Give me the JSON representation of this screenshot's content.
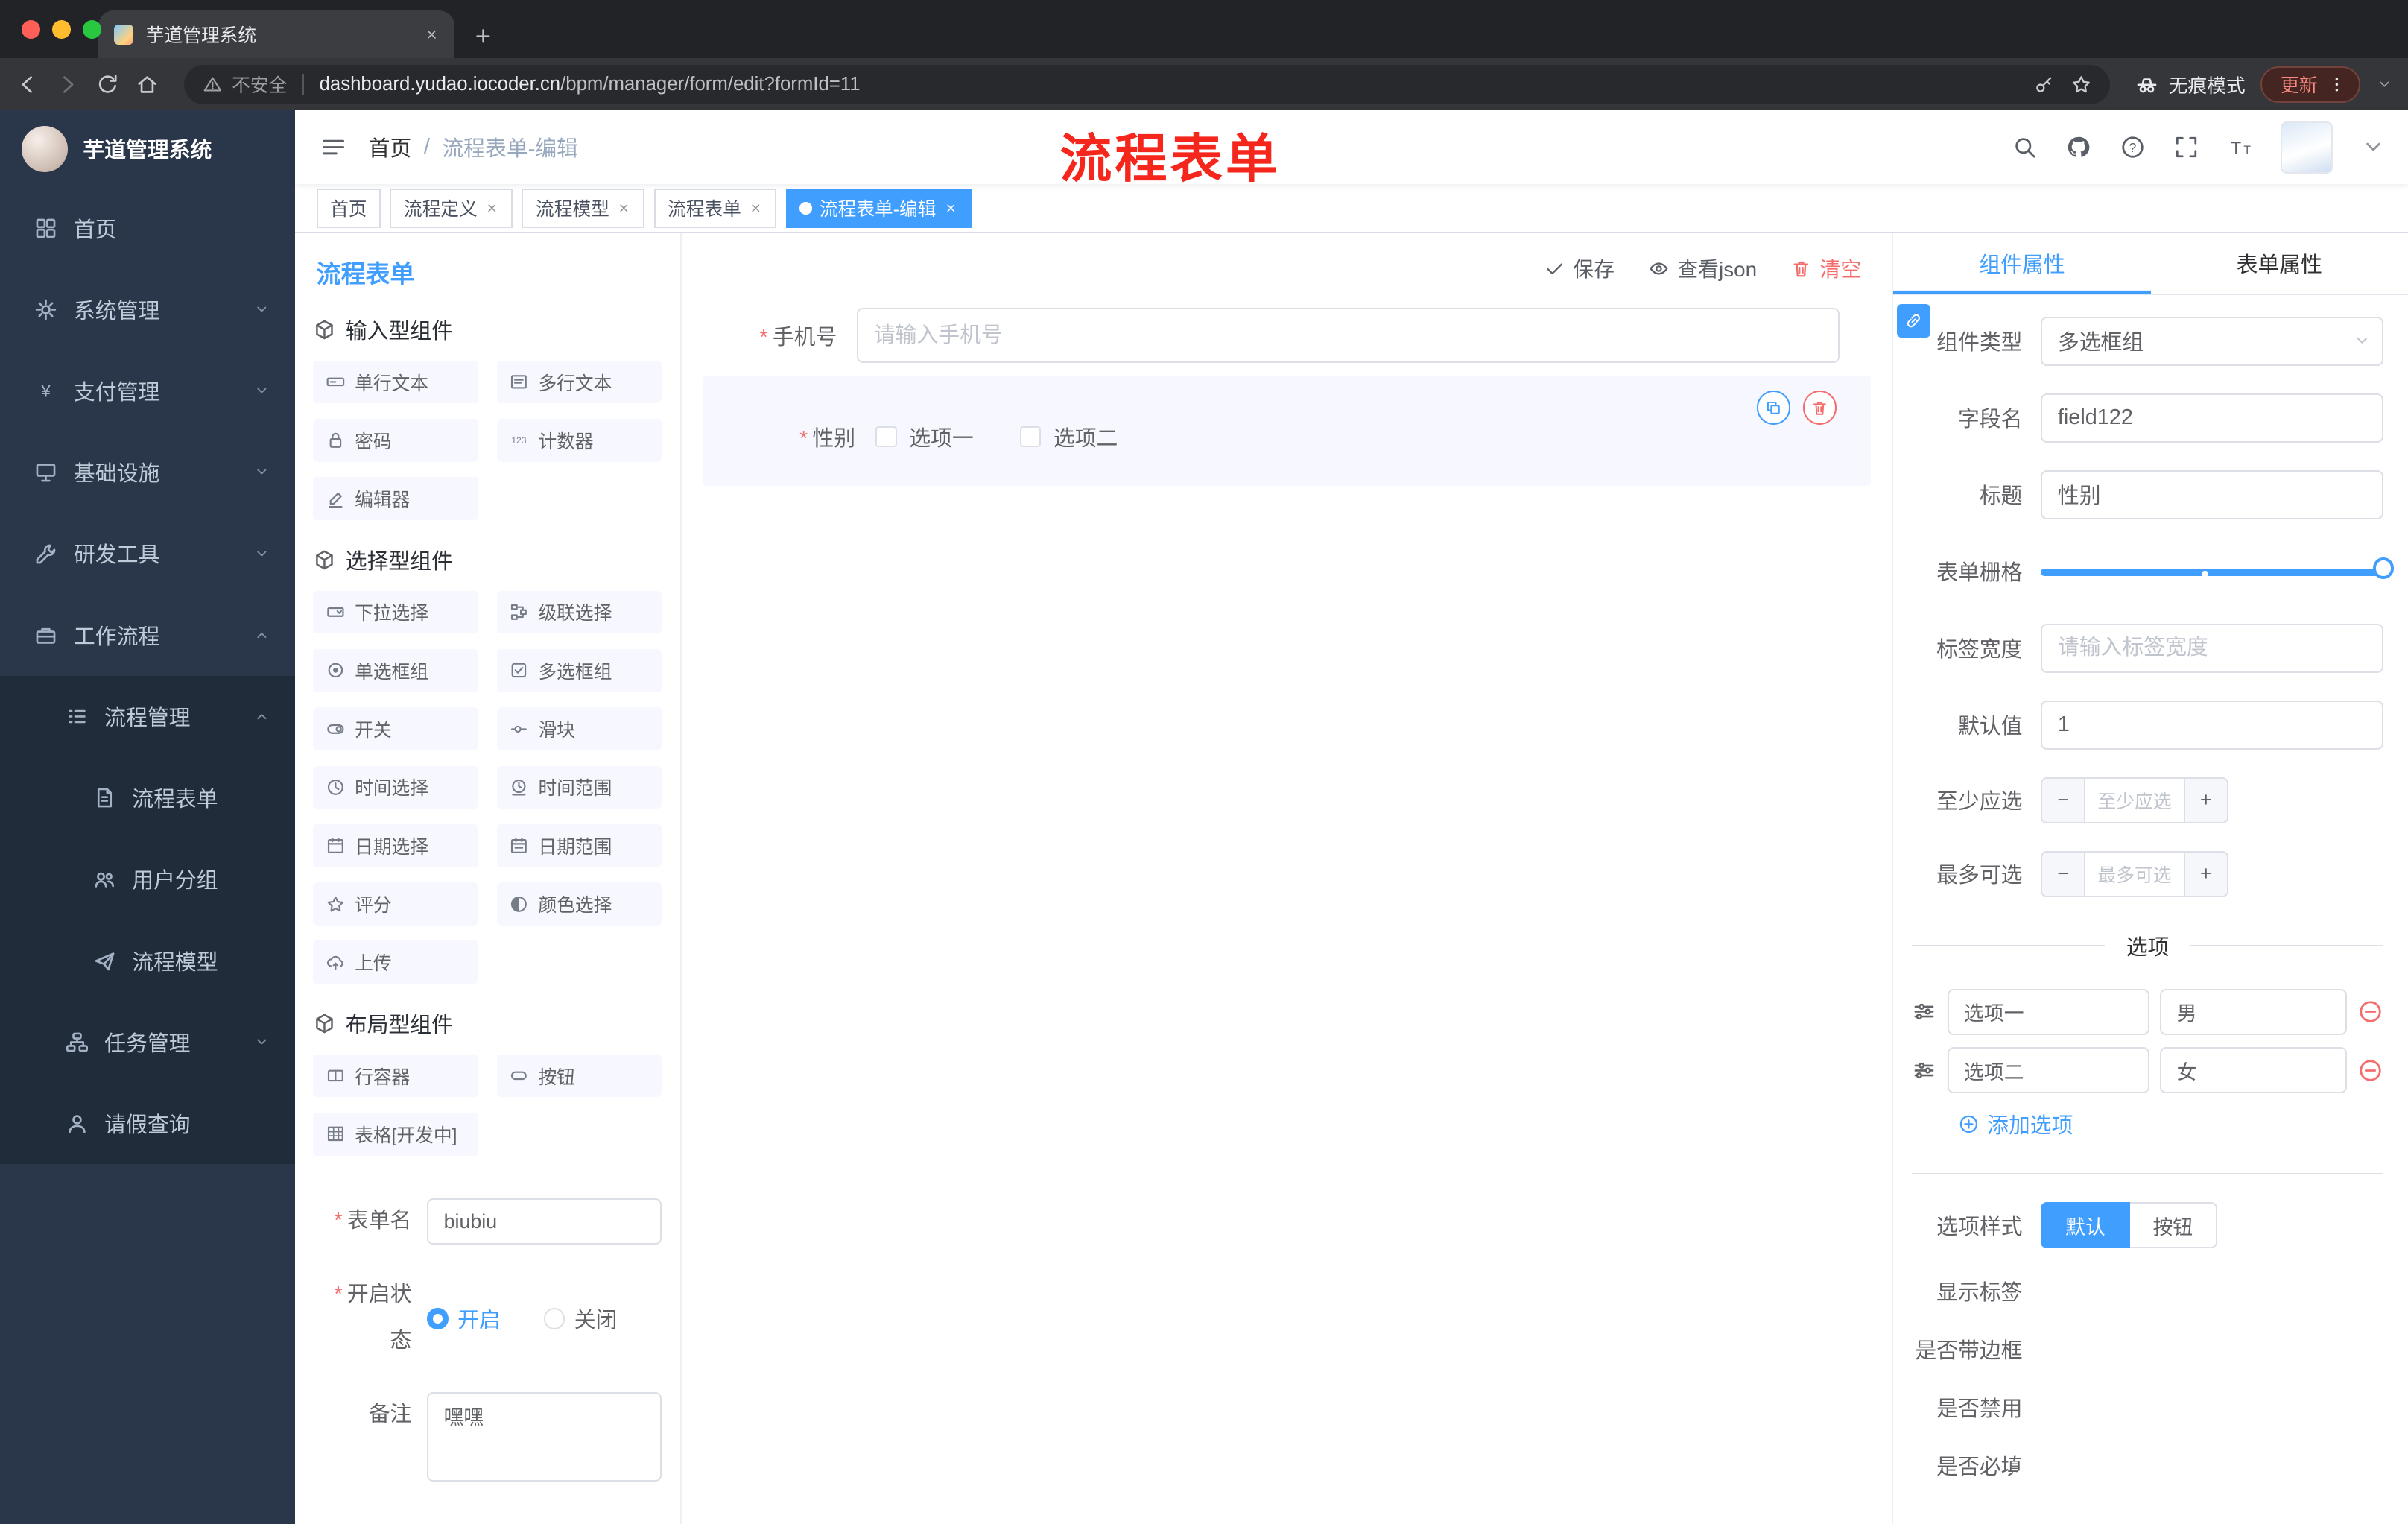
{
  "theme": {
    "primary": "#409eff",
    "danger": "#f56c6c",
    "annotation_red": "#f5261c",
    "sidebar_bg": "#2a3649"
  },
  "browser": {
    "tab_title": "芋道管理系统",
    "security_label": "不安全",
    "url_domain": "dashboard.yudao.iocoder.cn",
    "url_path": "/bpm/manager/form/edit?formId=11",
    "incognito_label": "无痕模式",
    "update_label": "更新"
  },
  "sidebar": {
    "title": "芋道管理系统",
    "items": [
      {
        "label": "首页"
      },
      {
        "label": "系统管理"
      },
      {
        "label": "支付管理"
      },
      {
        "label": "基础设施"
      },
      {
        "label": "研发工具"
      },
      {
        "label": "工作流程"
      },
      {
        "label": "流程管理"
      },
      {
        "label": "流程表单"
      },
      {
        "label": "用户分组"
      },
      {
        "label": "流程模型"
      },
      {
        "label": "任务管理"
      },
      {
        "label": "请假查询"
      }
    ]
  },
  "header": {
    "breadcrumb": [
      "首页",
      "流程表单-编辑"
    ],
    "annotation": "流程表单"
  },
  "tags": [
    {
      "label": "首页"
    },
    {
      "label": "流程定义"
    },
    {
      "label": "流程模型"
    },
    {
      "label": "流程表单"
    },
    {
      "label": "流程表单-编辑"
    }
  ],
  "builder": {
    "title": "流程表单",
    "actions": {
      "save": "保存",
      "view_json": "查看json",
      "clear": "清空"
    },
    "sections": [
      {
        "title": "输入型组件",
        "items": [
          "单行文本",
          "多行文本",
          "密码",
          "计数器",
          "编辑器"
        ]
      },
      {
        "title": "选择型组件",
        "items": [
          "下拉选择",
          "级联选择",
          "单选框组",
          "多选框组",
          "开关",
          "滑块",
          "时间选择",
          "时间范围",
          "日期选择",
          "日期范围",
          "评分",
          "颜色选择",
          "上传"
        ]
      },
      {
        "title": "布局型组件",
        "items": [
          "行容器",
          "按钮",
          "表格[开发中]"
        ]
      }
    ],
    "meta": {
      "name_label": "表单名",
      "name_value": "biubiu",
      "status_label": "开启状态",
      "status_on": "开启",
      "status_off": "关闭",
      "remark_label": "备注",
      "remark_value": "嘿嘿"
    }
  },
  "canvas": {
    "phone": {
      "label": "手机号",
      "placeholder": "请输入手机号"
    },
    "gender": {
      "label": "性别",
      "options": [
        "选项一",
        "选项二"
      ]
    }
  },
  "props": {
    "tabs": [
      "组件属性",
      "表单属性"
    ],
    "component_type": {
      "label": "组件类型",
      "value": "多选框组"
    },
    "field_name": {
      "label": "字段名",
      "value": "field122"
    },
    "title": {
      "label": "标题",
      "value": "性别"
    },
    "grid": {
      "label": "表单栅格"
    },
    "label_width": {
      "label": "标签宽度",
      "placeholder": "请输入标签宽度"
    },
    "default_value": {
      "label": "默认值",
      "value": "1"
    },
    "min_select": {
      "label": "至少应选",
      "placeholder": "至少应选"
    },
    "max_select": {
      "label": "最多可选",
      "placeholder": "最多可选"
    },
    "options_title": "选项",
    "options": [
      {
        "label": "选项一",
        "value": "男"
      },
      {
        "label": "选项二",
        "value": "女"
      }
    ],
    "add_option": "添加选项",
    "option_style": {
      "label": "选项样式",
      "choices": [
        "默认",
        "按钮"
      ]
    },
    "toggles": [
      {
        "label": "显示标签",
        "on": true
      },
      {
        "label": "是否带边框",
        "on": false
      },
      {
        "label": "是否禁用",
        "on": false
      },
      {
        "label": "是否必填",
        "on": true
      }
    ]
  }
}
